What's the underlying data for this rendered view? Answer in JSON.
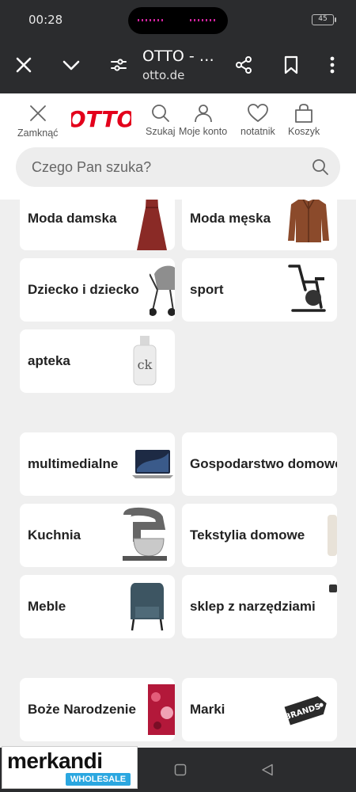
{
  "status_bar": {
    "time": "00:28",
    "battery": "45"
  },
  "browser": {
    "title": "OTTO - …",
    "url": "otto.de"
  },
  "header": {
    "close_label": "Zamknąć",
    "logo_text": "OTTO",
    "search_label": "Szukaj",
    "account_label": "Moje konto",
    "wishlist_label": "notatnik",
    "cart_label": "Koszyk"
  },
  "search": {
    "placeholder": "Czego Pan szuka?"
  },
  "categories": {
    "moda_damska": "Moda damska",
    "moda_meska": "Moda męska",
    "dziecko": "Dziecko i dziecko",
    "sport": "sport",
    "apteka": "apteka",
    "multimedialne": "multimedialne",
    "gospodarstwo": "Gospodarstwo domowe",
    "kuchnia": "Kuchnia",
    "tekstylia": "Tekstylia domowe",
    "meble": "Meble",
    "narzedzia": "sklep z narzędziami",
    "boze_narodzenie": "Boże Narodzenie",
    "marki": "Marki"
  },
  "product_image_text": {
    "perfume": "ck",
    "brands_tag": "BRANDS"
  },
  "watermark": {
    "word": "merkandi",
    "sub": "WHOLESALE"
  },
  "colors": {
    "otto_red": "#e3001b",
    "status_bg": "#2b2c2e",
    "content_bg": "#efefef",
    "merkandi_blue": "#2ba7e0"
  }
}
